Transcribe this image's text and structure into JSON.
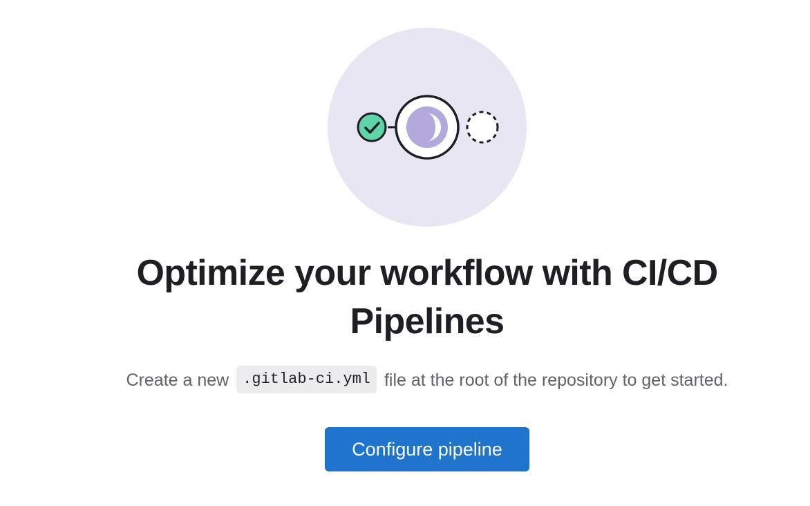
{
  "empty_state": {
    "illustration_icon": "pipeline-illustration",
    "title_line1": "Optimize your workflow with CI/CD",
    "title_line2": "Pipelines",
    "description_before": "Create a new",
    "description_code": ".gitlab-ci.yml",
    "description_after": "file at the root of the repository to get started.",
    "primary_button_label": "Configure pipeline"
  },
  "colors": {
    "illustration_background": "#e8e6f3",
    "success_green": "#5ed4a9",
    "running_purple": "#b3a9dc",
    "button_blue": "#1f75cb",
    "title_text": "#1f1e24",
    "body_text": "#626168"
  }
}
